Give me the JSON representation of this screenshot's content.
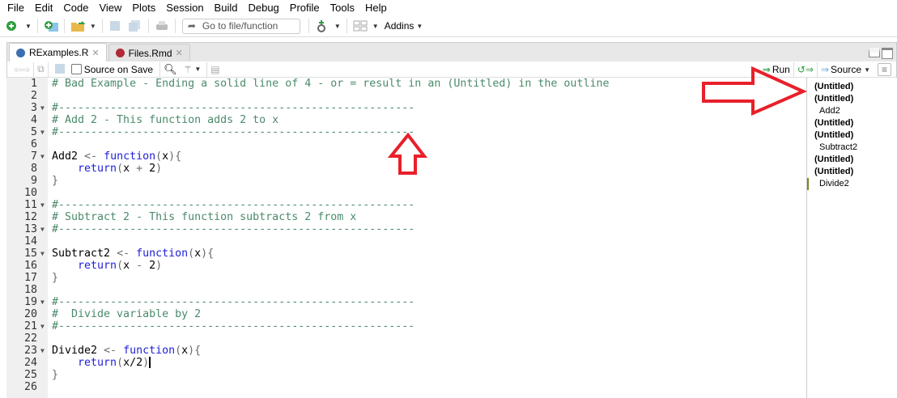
{
  "menu": [
    "File",
    "Edit",
    "Code",
    "View",
    "Plots",
    "Session",
    "Build",
    "Debug",
    "Profile",
    "Tools",
    "Help"
  ],
  "toolbar": {
    "goto_placeholder": "Go to file/function",
    "addins": "Addins"
  },
  "tabs": [
    {
      "label": "RExamples.R",
      "active": true
    },
    {
      "label": "Files.Rmd",
      "active": false
    }
  ],
  "editor_toolbar": {
    "source_on_save": "Source on Save",
    "run": "Run",
    "source": "Source"
  },
  "code": [
    [
      [
        "c",
        "# Bad Example - Ending a solid line of 4 - or = result in an (Untitled) in the outline"
      ]
    ],
    [],
    [
      [
        "c",
        "#-------------------------------------------------------"
      ]
    ],
    [
      [
        "c",
        "# Add 2 - This function adds 2 to x"
      ]
    ],
    [
      [
        "c",
        "#-------------------------------------------------------"
      ]
    ],
    [],
    [
      [
        "i",
        "Add2 "
      ],
      [
        "p",
        "<- "
      ],
      [
        "k",
        "function"
      ],
      [
        "p",
        "("
      ],
      [
        "i",
        "x"
      ],
      [
        "p",
        "){"
      ]
    ],
    [
      [
        "i",
        "    "
      ],
      [
        "k",
        "return"
      ],
      [
        "p",
        "("
      ],
      [
        "i",
        "x "
      ],
      [
        "p",
        "+ "
      ],
      [
        "i",
        "2"
      ],
      [
        "p",
        ")"
      ]
    ],
    [
      [
        "p",
        "}"
      ]
    ],
    [],
    [
      [
        "c",
        "#-------------------------------------------------------"
      ]
    ],
    [
      [
        "c",
        "# Subtract 2 - This function subtracts 2 from x"
      ]
    ],
    [
      [
        "c",
        "#-------------------------------------------------------"
      ]
    ],
    [],
    [
      [
        "i",
        "Subtract2 "
      ],
      [
        "p",
        "<- "
      ],
      [
        "k",
        "function"
      ],
      [
        "p",
        "("
      ],
      [
        "i",
        "x"
      ],
      [
        "p",
        "){"
      ]
    ],
    [
      [
        "i",
        "    "
      ],
      [
        "k",
        "return"
      ],
      [
        "p",
        "("
      ],
      [
        "i",
        "x "
      ],
      [
        "p",
        "- "
      ],
      [
        "i",
        "2"
      ],
      [
        "p",
        ")"
      ]
    ],
    [
      [
        "p",
        "}"
      ]
    ],
    [],
    [
      [
        "c",
        "#-------------------------------------------------------"
      ]
    ],
    [
      [
        "c",
        "#  Divide variable by 2"
      ]
    ],
    [
      [
        "c",
        "#-------------------------------------------------------"
      ]
    ],
    [],
    [
      [
        "i",
        "Divide2 "
      ],
      [
        "p",
        "<- "
      ],
      [
        "k",
        "function"
      ],
      [
        "p",
        "("
      ],
      [
        "i",
        "x"
      ],
      [
        "p",
        "){"
      ]
    ],
    [
      [
        "i",
        "    "
      ],
      [
        "k",
        "return"
      ],
      [
        "p",
        "("
      ],
      [
        "i",
        "x/2"
      ],
      [
        "p",
        ")"
      ]
    ],
    [
      [
        "p",
        "}"
      ]
    ],
    []
  ],
  "fold_lines": [
    3,
    5,
    7,
    11,
    13,
    15,
    19,
    21,
    23
  ],
  "outline": [
    {
      "label": "(Untitled)",
      "kind": "b"
    },
    {
      "label": "(Untitled)",
      "kind": "b"
    },
    {
      "label": "Add2",
      "kind": "n"
    },
    {
      "label": "(Untitled)",
      "kind": "b"
    },
    {
      "label": "(Untitled)",
      "kind": "b"
    },
    {
      "label": "Subtract2",
      "kind": "n"
    },
    {
      "label": "(Untitled)",
      "kind": "b"
    },
    {
      "label": "(Untitled)",
      "kind": "b"
    },
    {
      "label": "Divide2",
      "kind": "sel"
    }
  ],
  "colors": {
    "annotation_arrow": "#e8202a"
  }
}
